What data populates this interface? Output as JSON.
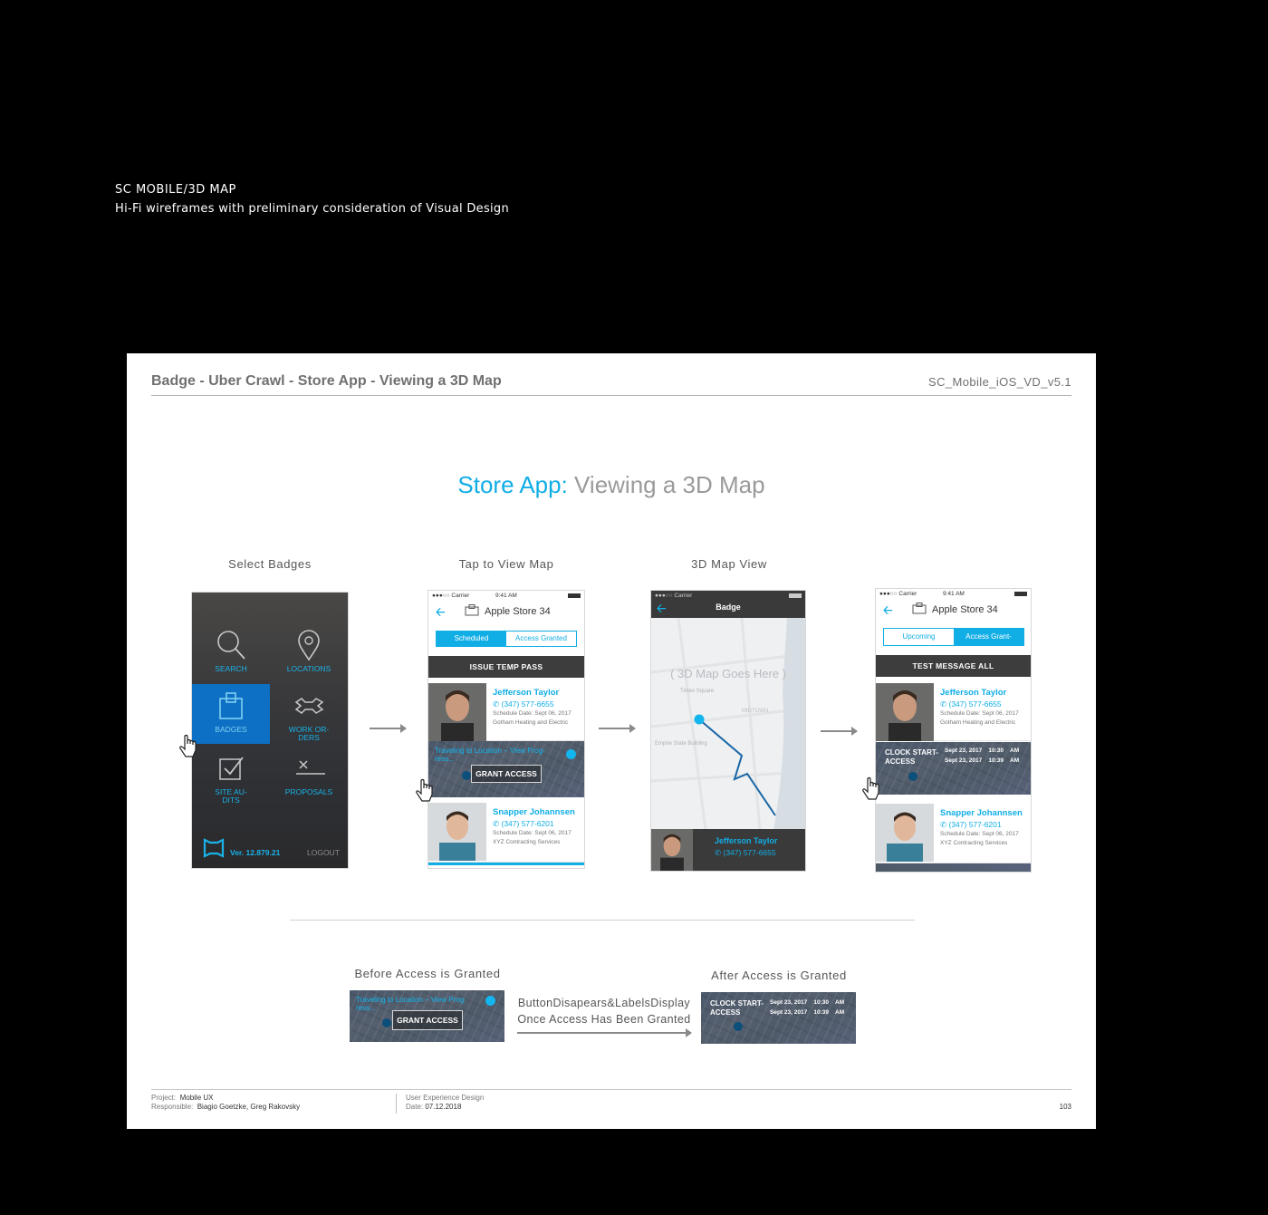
{
  "page": {
    "title": "SC MOBILE/3D MAP",
    "subtitle": "Hi-Fi wireframes with preliminary consideration of Visual Design"
  },
  "sheet": {
    "title": "Badge - Uber Crawl - Store App - Viewing a 3D Map",
    "version": "SC_Mobile_iOS_VD_v5.1",
    "headline_accent": "Store App:",
    "headline_rest": " Viewing a 3D Map",
    "step_labels": [
      "Select Badges",
      "Tap to View Map",
      "3D Map View"
    ],
    "footer": {
      "project_label": "Project:",
      "project": "Mobile UX",
      "responsible_label": "Responsible:",
      "responsible": "Biagio Goetzke, Greg Rakovsky",
      "dept": "User Experience Design",
      "date_label": "Date:",
      "date": "07.12.2018",
      "page_number": "103"
    }
  },
  "menu_screen": {
    "tiles": [
      "SEARCH",
      "LOCATIONS",
      "BADGES",
      "WORK OR-\nDERS",
      "SITE AU-\nDITS",
      "PROPOSALS"
    ],
    "version": "Ver. 12.879.21",
    "logout": "LOGOUT"
  },
  "status_bar": {
    "carrier": "●●●○○ Carrier",
    "time": "9:41 AM"
  },
  "store_screen": {
    "store_name": "Apple Store 34",
    "tab_scheduled": "Scheduled",
    "tab_access": "Access Granted",
    "issue_bar": "ISSUE  TEMP  PASS",
    "contacts": [
      {
        "name": "Jefferson Taylor",
        "phone": "(347) 577-6655",
        "schedule": "Schedule Date:  Sept 06, 2017",
        "company": "Gotham Heating and Electric"
      },
      {
        "name": "Snapper Johannsen",
        "phone": "(347) 577-6201",
        "schedule": "Schedule Date:  Sept 06, 2017",
        "company": "XYZ Contracting Services"
      }
    ],
    "traveling": "Traveling to Location – View Prog-\nress...",
    "grant_access": "GRANT ACCESS"
  },
  "map_screen": {
    "nav_title": "Badge",
    "placeholder": "( 3D Map Goes Here )",
    "map_labels": [
      "Times Square",
      "MIDTOWN",
      "Empire State Building"
    ],
    "contact_name": "Jefferson Taylor",
    "contact_phone": "(347) 577-6655"
  },
  "granted_screen": {
    "store_name": "Apple Store 34",
    "tab_upcoming": "Upcoming",
    "tab_access": "Access Grant-",
    "message_bar": "TEST MESSAGE ALL",
    "clock_label": "CLOCK START-\nACCESS",
    "clock_row1": "Sept 23, 2017    10:30    AM",
    "clock_row2": "Sept 23, 2017    10:39    AM"
  },
  "comparison": {
    "before_label": "Before Access is Granted",
    "after_label": "After Access is Granted",
    "note_line1": "ButtonDisapears&LabelsDisplay",
    "note_line2": "Once Access Has Been Granted"
  },
  "colors": {
    "accent": "#11aee6",
    "badge_tile": "#0d70c4",
    "dark_bar": "#3d3d3d"
  },
  "icons": [
    "search-icon",
    "location-pin-icon",
    "badge-icon",
    "wrench-icon",
    "checkbox-icon",
    "proposal-icon",
    "back-arrow-icon",
    "store-icon",
    "phone-icon",
    "hand-pointer-icon",
    "logo-icon"
  ]
}
